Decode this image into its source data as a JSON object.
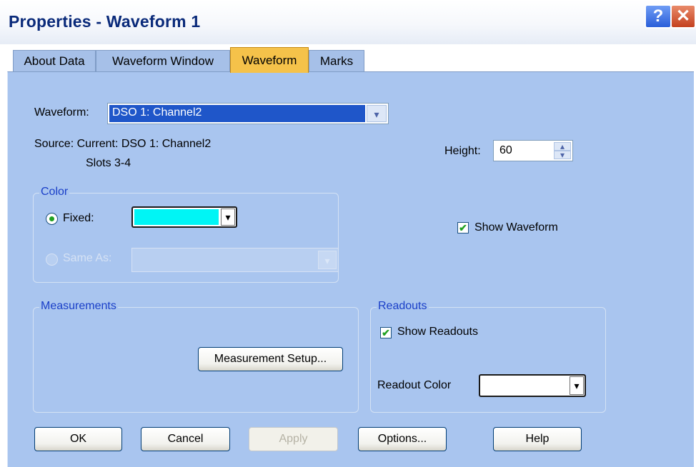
{
  "window": {
    "title": "Properties - Waveform 1",
    "help_glyph": "?",
    "close_glyph": "✕"
  },
  "tabs": [
    {
      "label": "About Data"
    },
    {
      "label": "Waveform Window"
    },
    {
      "label": "Waveform"
    },
    {
      "label": "Marks"
    }
  ],
  "active_tab": "Waveform",
  "waveform": {
    "label": "Waveform:",
    "selected": "DSO 1: Channel2",
    "source_line1": "Source: Current: DSO 1: Channel2",
    "source_line2": "Slots 3-4"
  },
  "height": {
    "label": "Height:",
    "value": "60"
  },
  "color_group": {
    "title": "Color",
    "fixed_label": "Fixed:",
    "fixed_selected": true,
    "fixed_color": "#00f5f5",
    "same_as_label": "Same As:",
    "same_as_enabled": false
  },
  "show_waveform": {
    "label": "Show Waveform",
    "checked": true
  },
  "measurements_group": {
    "title": "Measurements",
    "setup_button": "Measurement Setup..."
  },
  "readouts_group": {
    "title": "Readouts",
    "show_readouts_label": "Show Readouts",
    "show_readouts_checked": true,
    "readout_color_label": "Readout Color",
    "readout_color": "#ffffff"
  },
  "buttons": {
    "ok": "OK",
    "cancel": "Cancel",
    "apply": "Apply",
    "options": "Options...",
    "help": "Help"
  },
  "glyphs": {
    "check": "✔",
    "dropdown": "▾",
    "spin_up": "▴",
    "spin_down": "▾"
  },
  "colors": {
    "panel": "#a9c5ef",
    "active_tab": "#f5c24a",
    "title_text": "#0a2a7a",
    "group_title": "#1a3fc8"
  }
}
